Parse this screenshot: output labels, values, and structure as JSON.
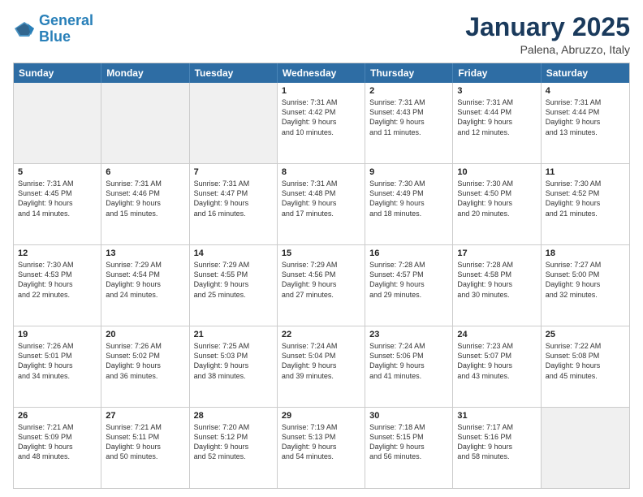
{
  "header": {
    "logo_line1": "General",
    "logo_line2": "Blue",
    "month_title": "January 2025",
    "subtitle": "Palena, Abruzzo, Italy"
  },
  "days_of_week": [
    "Sunday",
    "Monday",
    "Tuesday",
    "Wednesday",
    "Thursday",
    "Friday",
    "Saturday"
  ],
  "weeks": [
    [
      {
        "day": "",
        "text": ""
      },
      {
        "day": "",
        "text": ""
      },
      {
        "day": "",
        "text": ""
      },
      {
        "day": "1",
        "text": "Sunrise: 7:31 AM\nSunset: 4:42 PM\nDaylight: 9 hours\nand 10 minutes."
      },
      {
        "day": "2",
        "text": "Sunrise: 7:31 AM\nSunset: 4:43 PM\nDaylight: 9 hours\nand 11 minutes."
      },
      {
        "day": "3",
        "text": "Sunrise: 7:31 AM\nSunset: 4:44 PM\nDaylight: 9 hours\nand 12 minutes."
      },
      {
        "day": "4",
        "text": "Sunrise: 7:31 AM\nSunset: 4:44 PM\nDaylight: 9 hours\nand 13 minutes."
      }
    ],
    [
      {
        "day": "5",
        "text": "Sunrise: 7:31 AM\nSunset: 4:45 PM\nDaylight: 9 hours\nand 14 minutes."
      },
      {
        "day": "6",
        "text": "Sunrise: 7:31 AM\nSunset: 4:46 PM\nDaylight: 9 hours\nand 15 minutes."
      },
      {
        "day": "7",
        "text": "Sunrise: 7:31 AM\nSunset: 4:47 PM\nDaylight: 9 hours\nand 16 minutes."
      },
      {
        "day": "8",
        "text": "Sunrise: 7:31 AM\nSunset: 4:48 PM\nDaylight: 9 hours\nand 17 minutes."
      },
      {
        "day": "9",
        "text": "Sunrise: 7:30 AM\nSunset: 4:49 PM\nDaylight: 9 hours\nand 18 minutes."
      },
      {
        "day": "10",
        "text": "Sunrise: 7:30 AM\nSunset: 4:50 PM\nDaylight: 9 hours\nand 20 minutes."
      },
      {
        "day": "11",
        "text": "Sunrise: 7:30 AM\nSunset: 4:52 PM\nDaylight: 9 hours\nand 21 minutes."
      }
    ],
    [
      {
        "day": "12",
        "text": "Sunrise: 7:30 AM\nSunset: 4:53 PM\nDaylight: 9 hours\nand 22 minutes."
      },
      {
        "day": "13",
        "text": "Sunrise: 7:29 AM\nSunset: 4:54 PM\nDaylight: 9 hours\nand 24 minutes."
      },
      {
        "day": "14",
        "text": "Sunrise: 7:29 AM\nSunset: 4:55 PM\nDaylight: 9 hours\nand 25 minutes."
      },
      {
        "day": "15",
        "text": "Sunrise: 7:29 AM\nSunset: 4:56 PM\nDaylight: 9 hours\nand 27 minutes."
      },
      {
        "day": "16",
        "text": "Sunrise: 7:28 AM\nSunset: 4:57 PM\nDaylight: 9 hours\nand 29 minutes."
      },
      {
        "day": "17",
        "text": "Sunrise: 7:28 AM\nSunset: 4:58 PM\nDaylight: 9 hours\nand 30 minutes."
      },
      {
        "day": "18",
        "text": "Sunrise: 7:27 AM\nSunset: 5:00 PM\nDaylight: 9 hours\nand 32 minutes."
      }
    ],
    [
      {
        "day": "19",
        "text": "Sunrise: 7:26 AM\nSunset: 5:01 PM\nDaylight: 9 hours\nand 34 minutes."
      },
      {
        "day": "20",
        "text": "Sunrise: 7:26 AM\nSunset: 5:02 PM\nDaylight: 9 hours\nand 36 minutes."
      },
      {
        "day": "21",
        "text": "Sunrise: 7:25 AM\nSunset: 5:03 PM\nDaylight: 9 hours\nand 38 minutes."
      },
      {
        "day": "22",
        "text": "Sunrise: 7:24 AM\nSunset: 5:04 PM\nDaylight: 9 hours\nand 39 minutes."
      },
      {
        "day": "23",
        "text": "Sunrise: 7:24 AM\nSunset: 5:06 PM\nDaylight: 9 hours\nand 41 minutes."
      },
      {
        "day": "24",
        "text": "Sunrise: 7:23 AM\nSunset: 5:07 PM\nDaylight: 9 hours\nand 43 minutes."
      },
      {
        "day": "25",
        "text": "Sunrise: 7:22 AM\nSunset: 5:08 PM\nDaylight: 9 hours\nand 45 minutes."
      }
    ],
    [
      {
        "day": "26",
        "text": "Sunrise: 7:21 AM\nSunset: 5:09 PM\nDaylight: 9 hours\nand 48 minutes."
      },
      {
        "day": "27",
        "text": "Sunrise: 7:21 AM\nSunset: 5:11 PM\nDaylight: 9 hours\nand 50 minutes."
      },
      {
        "day": "28",
        "text": "Sunrise: 7:20 AM\nSunset: 5:12 PM\nDaylight: 9 hours\nand 52 minutes."
      },
      {
        "day": "29",
        "text": "Sunrise: 7:19 AM\nSunset: 5:13 PM\nDaylight: 9 hours\nand 54 minutes."
      },
      {
        "day": "30",
        "text": "Sunrise: 7:18 AM\nSunset: 5:15 PM\nDaylight: 9 hours\nand 56 minutes."
      },
      {
        "day": "31",
        "text": "Sunrise: 7:17 AM\nSunset: 5:16 PM\nDaylight: 9 hours\nand 58 minutes."
      },
      {
        "day": "",
        "text": ""
      }
    ]
  ]
}
